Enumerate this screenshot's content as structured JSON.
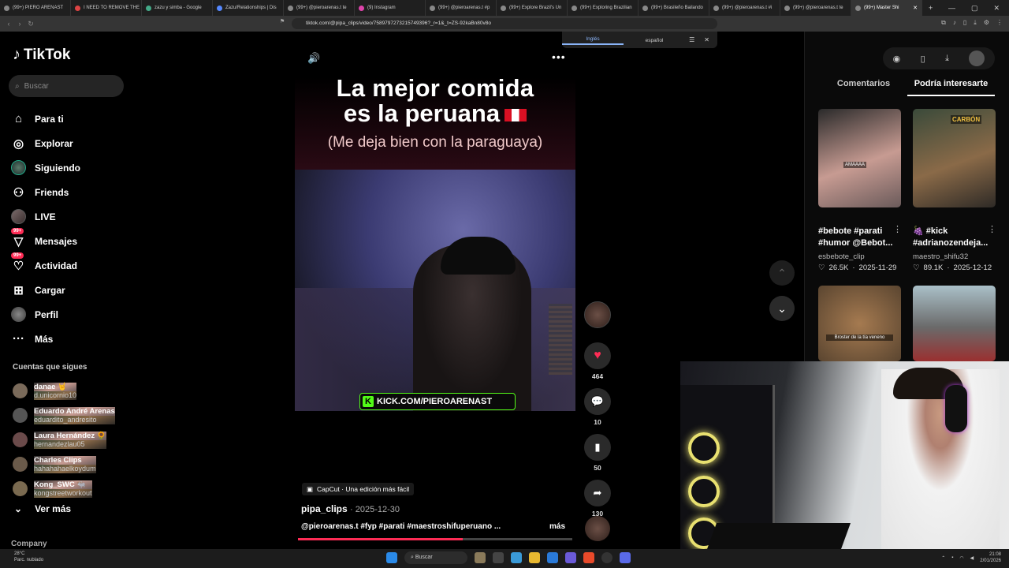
{
  "browser": {
    "tabs": [
      {
        "label": "(99+) PIERO ARENAST"
      },
      {
        "label": "I NEED TO REMOVE THE"
      },
      {
        "label": "zazu y simba - Google"
      },
      {
        "label": "Zazu/Relationships | Dis"
      },
      {
        "label": "(99+) @pieroarenas.t te"
      },
      {
        "label": "(9) Instagram"
      },
      {
        "label": "(99+) @pieroarenas.t #p"
      },
      {
        "label": "(99+) Explore Brazil's Un"
      },
      {
        "label": "(99+) Exploring Brazilian"
      },
      {
        "label": "(99+) Brasileño Bailando"
      },
      {
        "label": "(99+) @pieroarenas.t #i"
      },
      {
        "label": "(99+) @pieroarenas.t te"
      },
      {
        "label": "(99+) Master Shi"
      }
    ],
    "url": "tiktok.com/@pipa_clips/video/7589797273215749396?_r=1&_t=ZS-92kaBn80v8o",
    "translate": {
      "source": "Inglés",
      "target": "español"
    }
  },
  "sidebar": {
    "logo": "TikTok",
    "search_placeholder": "Buscar",
    "nav": [
      {
        "label": "Para ti",
        "icon": "home-icon"
      },
      {
        "label": "Explorar",
        "icon": "compass-icon"
      },
      {
        "label": "Siguiendo",
        "icon": "avatar-icon"
      },
      {
        "label": "Friends",
        "icon": "friends-icon"
      },
      {
        "label": "LIVE",
        "icon": "live-avatar-icon"
      },
      {
        "label": "Mensajes",
        "icon": "message-icon",
        "badge": "99+"
      },
      {
        "label": "Actividad",
        "icon": "activity-icon",
        "badge": "99+"
      },
      {
        "label": "Cargar",
        "icon": "upload-icon"
      },
      {
        "label": "Perfil",
        "icon": "profile-icon"
      },
      {
        "label": "Más",
        "icon": "more-icon"
      }
    ],
    "following_header": "Cuentas que sigues",
    "following": [
      {
        "name": "danae 🤘",
        "handle": "d.unicornio10"
      },
      {
        "name": "Eduardo André Arenas",
        "handle": "eduardito_andresito"
      },
      {
        "name": "Laura Hernández 🌻",
        "handle": "hernandezlau05"
      },
      {
        "name": "Charles Clips",
        "handle": "hahahahaelkoydum"
      },
      {
        "name": "Kong_SWC 🐃",
        "handle": "kongstreetworkout"
      }
    ],
    "see_more": "Ver más",
    "company": "Company"
  },
  "video": {
    "caption_line1": "La mejor comida",
    "caption_line2": "es la peruana",
    "caption_sub": "(Me deja bien con la paraguaya)",
    "kick_text": "KICK.COM/PIEROARENAST",
    "capcut": "CapCut · Una edición más fácil",
    "author": "pipa_clips",
    "date": "· 2025-12-30",
    "description": "@pieroarenas.t #fyp #parati #maestroshifuperuano ...",
    "more": "más",
    "progress": 0.6
  },
  "actions": {
    "likes": "464",
    "comments": "10",
    "saves": "50",
    "shares": "130"
  },
  "right_panel": {
    "tabs": [
      "Comentarios",
      "Podría interesarte"
    ],
    "cards": [
      {
        "title": "#bebote #parati #humor @Bebot...",
        "user": "esbebote_clip",
        "likes": "26.5K",
        "date": "2025-11-29",
        "overlay": "AMAAAA"
      },
      {
        "title": "🍇 #kick #adrianozendeja...",
        "user": "maestro_shifu32",
        "likes": "89.1K",
        "date": "2025-12-12",
        "overlay": "CARBÓN"
      },
      {
        "overlay": "Broster de la tía veneno"
      }
    ]
  },
  "taskbar": {
    "weather_temp": "28°C",
    "weather_text": "Parc. nublado",
    "search": "Buscar",
    "time": "21:08",
    "date": "2/01/2026"
  },
  "colors": {
    "accent": "#fe2c55",
    "kick": "#53fc18"
  }
}
